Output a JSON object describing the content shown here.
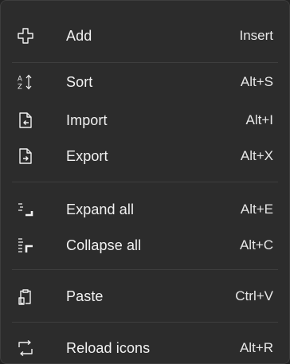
{
  "menu": {
    "items": [
      {
        "icon": "add-plus-icon",
        "label": "Add",
        "shortcut": "Insert"
      },
      {
        "icon": "sort-az-icon",
        "label": "Sort",
        "shortcut": "Alt+S"
      },
      {
        "icon": "import-document-icon",
        "label": "Import",
        "shortcut": "Alt+I"
      },
      {
        "icon": "export-document-icon",
        "label": "Export",
        "shortcut": "Alt+X"
      },
      {
        "icon": "expand-all-icon",
        "label": "Expand all",
        "shortcut": "Alt+E"
      },
      {
        "icon": "collapse-all-icon",
        "label": "Collapse all",
        "shortcut": "Alt+C"
      },
      {
        "icon": "paste-clipboard-icon",
        "label": "Paste",
        "shortcut": "Ctrl+V"
      },
      {
        "icon": "reload-icon",
        "label": "Reload icons",
        "shortcut": "Alt+R"
      }
    ]
  },
  "colors": {
    "background": "#2c2c2c",
    "text": "#f2f2f2",
    "separator": "#3e3e3e"
  }
}
